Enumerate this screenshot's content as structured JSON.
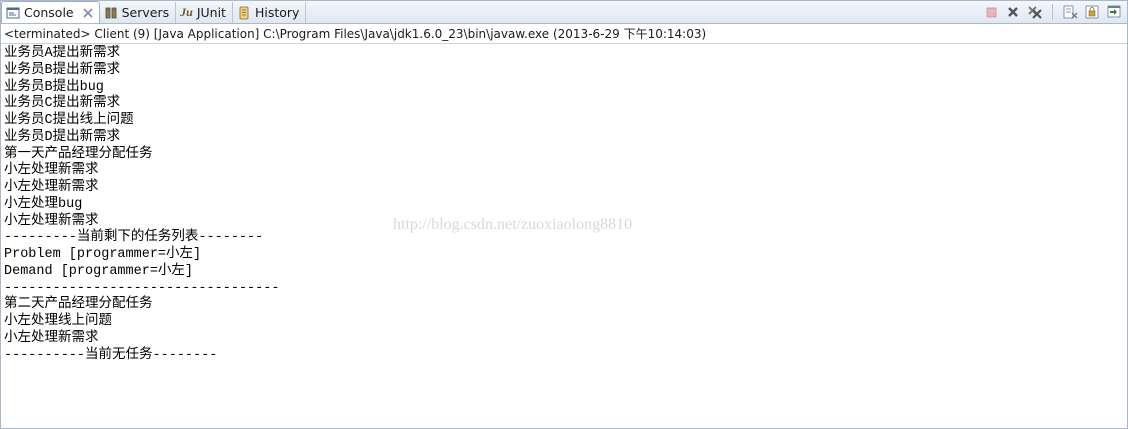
{
  "tabs": [
    {
      "label": "Console",
      "icon": "console-icon",
      "active": true
    },
    {
      "label": "Servers",
      "icon": "servers-icon",
      "active": false
    },
    {
      "label": "JUnit",
      "icon": "junit-icon",
      "active": false
    },
    {
      "label": "History",
      "icon": "history-icon",
      "active": false
    }
  ],
  "junit_icon_text": "Ju",
  "status": "<terminated> Client (9) [Java Application] C:\\Program Files\\Java\\jdk1.6.0_23\\bin\\javaw.exe (2013-6-29 下午10:14:03)",
  "console_lines": [
    "业务员A提出新需求",
    "业务员B提出新需求",
    "业务员B提出bug",
    "业务员C提出新需求",
    "业务员C提出线上问题",
    "业务员D提出新需求",
    "第一天产品经理分配任务",
    "小左处理新需求",
    "小左处理新需求",
    "小左处理bug",
    "小左处理新需求",
    "---------当前剩下的任务列表--------",
    "Problem [programmer=小左]",
    "Demand [programmer=小左]",
    "----------------------------------",
    "第二天产品经理分配任务",
    "小左处理线上问题",
    "小左处理新需求",
    "----------当前无任务--------"
  ],
  "watermark": "http://blog.csdn.net/zuoxiaolong8810",
  "colors": {
    "tab_bar": "#dfe7f1",
    "border": "#a9b8cc",
    "terminate_red": "#c0455a",
    "icon_gray": "#6d6d6d"
  }
}
